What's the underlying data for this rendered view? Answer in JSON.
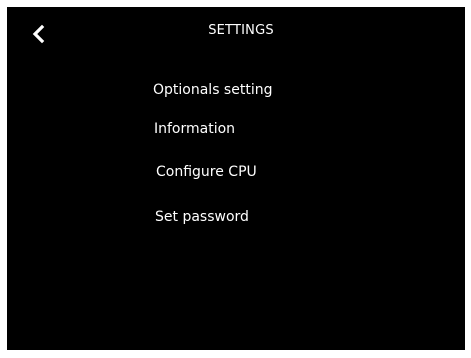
{
  "header": {
    "title": "SETTINGS",
    "back_icon": "chevron-left-icon"
  },
  "menu": {
    "items": [
      {
        "label": "Optionals setting"
      },
      {
        "label": "Information"
      },
      {
        "label": "Configure CPU"
      },
      {
        "label": "Set password"
      }
    ]
  },
  "colors": {
    "background": "#000000",
    "text": "#ffffff",
    "frame": "#ffffff"
  }
}
